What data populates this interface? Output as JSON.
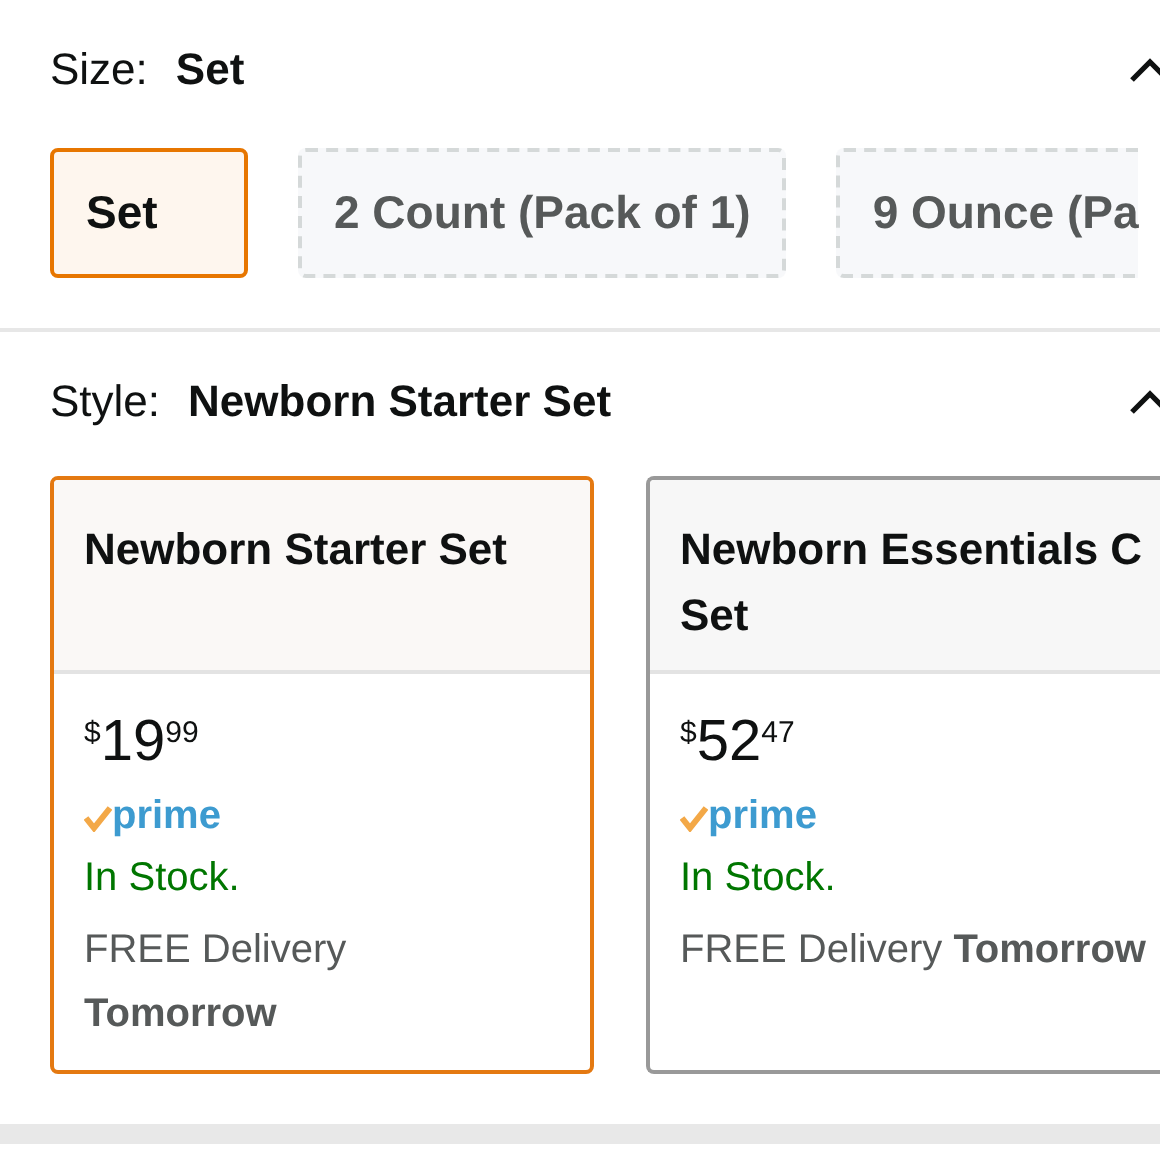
{
  "size_section": {
    "label": "Size:",
    "value": "Set",
    "expanded": true,
    "options": [
      {
        "label": "Set",
        "selected": true
      },
      {
        "label": "2 Count (Pack of 1)",
        "selected": false
      },
      {
        "label": "9 Ounce (Pa",
        "selected": false
      }
    ]
  },
  "style_section": {
    "label": "Style:",
    "value": "Newborn Starter Set",
    "expanded": true,
    "options": [
      {
        "title_lines": [
          "Newborn Starter Set"
        ],
        "selected": true,
        "price_dollars": "19",
        "price_cents": "99",
        "currency": "$",
        "prime": "prime",
        "stock": "In Stock.",
        "delivery": "FREE Delivery",
        "delivery_day": "Tomorrow"
      },
      {
        "title_lines": [
          "Newborn Essentials C",
          "Set"
        ],
        "selected": false,
        "price_dollars": "52",
        "price_cents": "47",
        "currency": "$",
        "prime": "prime",
        "stock": "In Stock.",
        "delivery": "FREE Delivery",
        "delivery_day": "Tomorrow"
      }
    ]
  }
}
